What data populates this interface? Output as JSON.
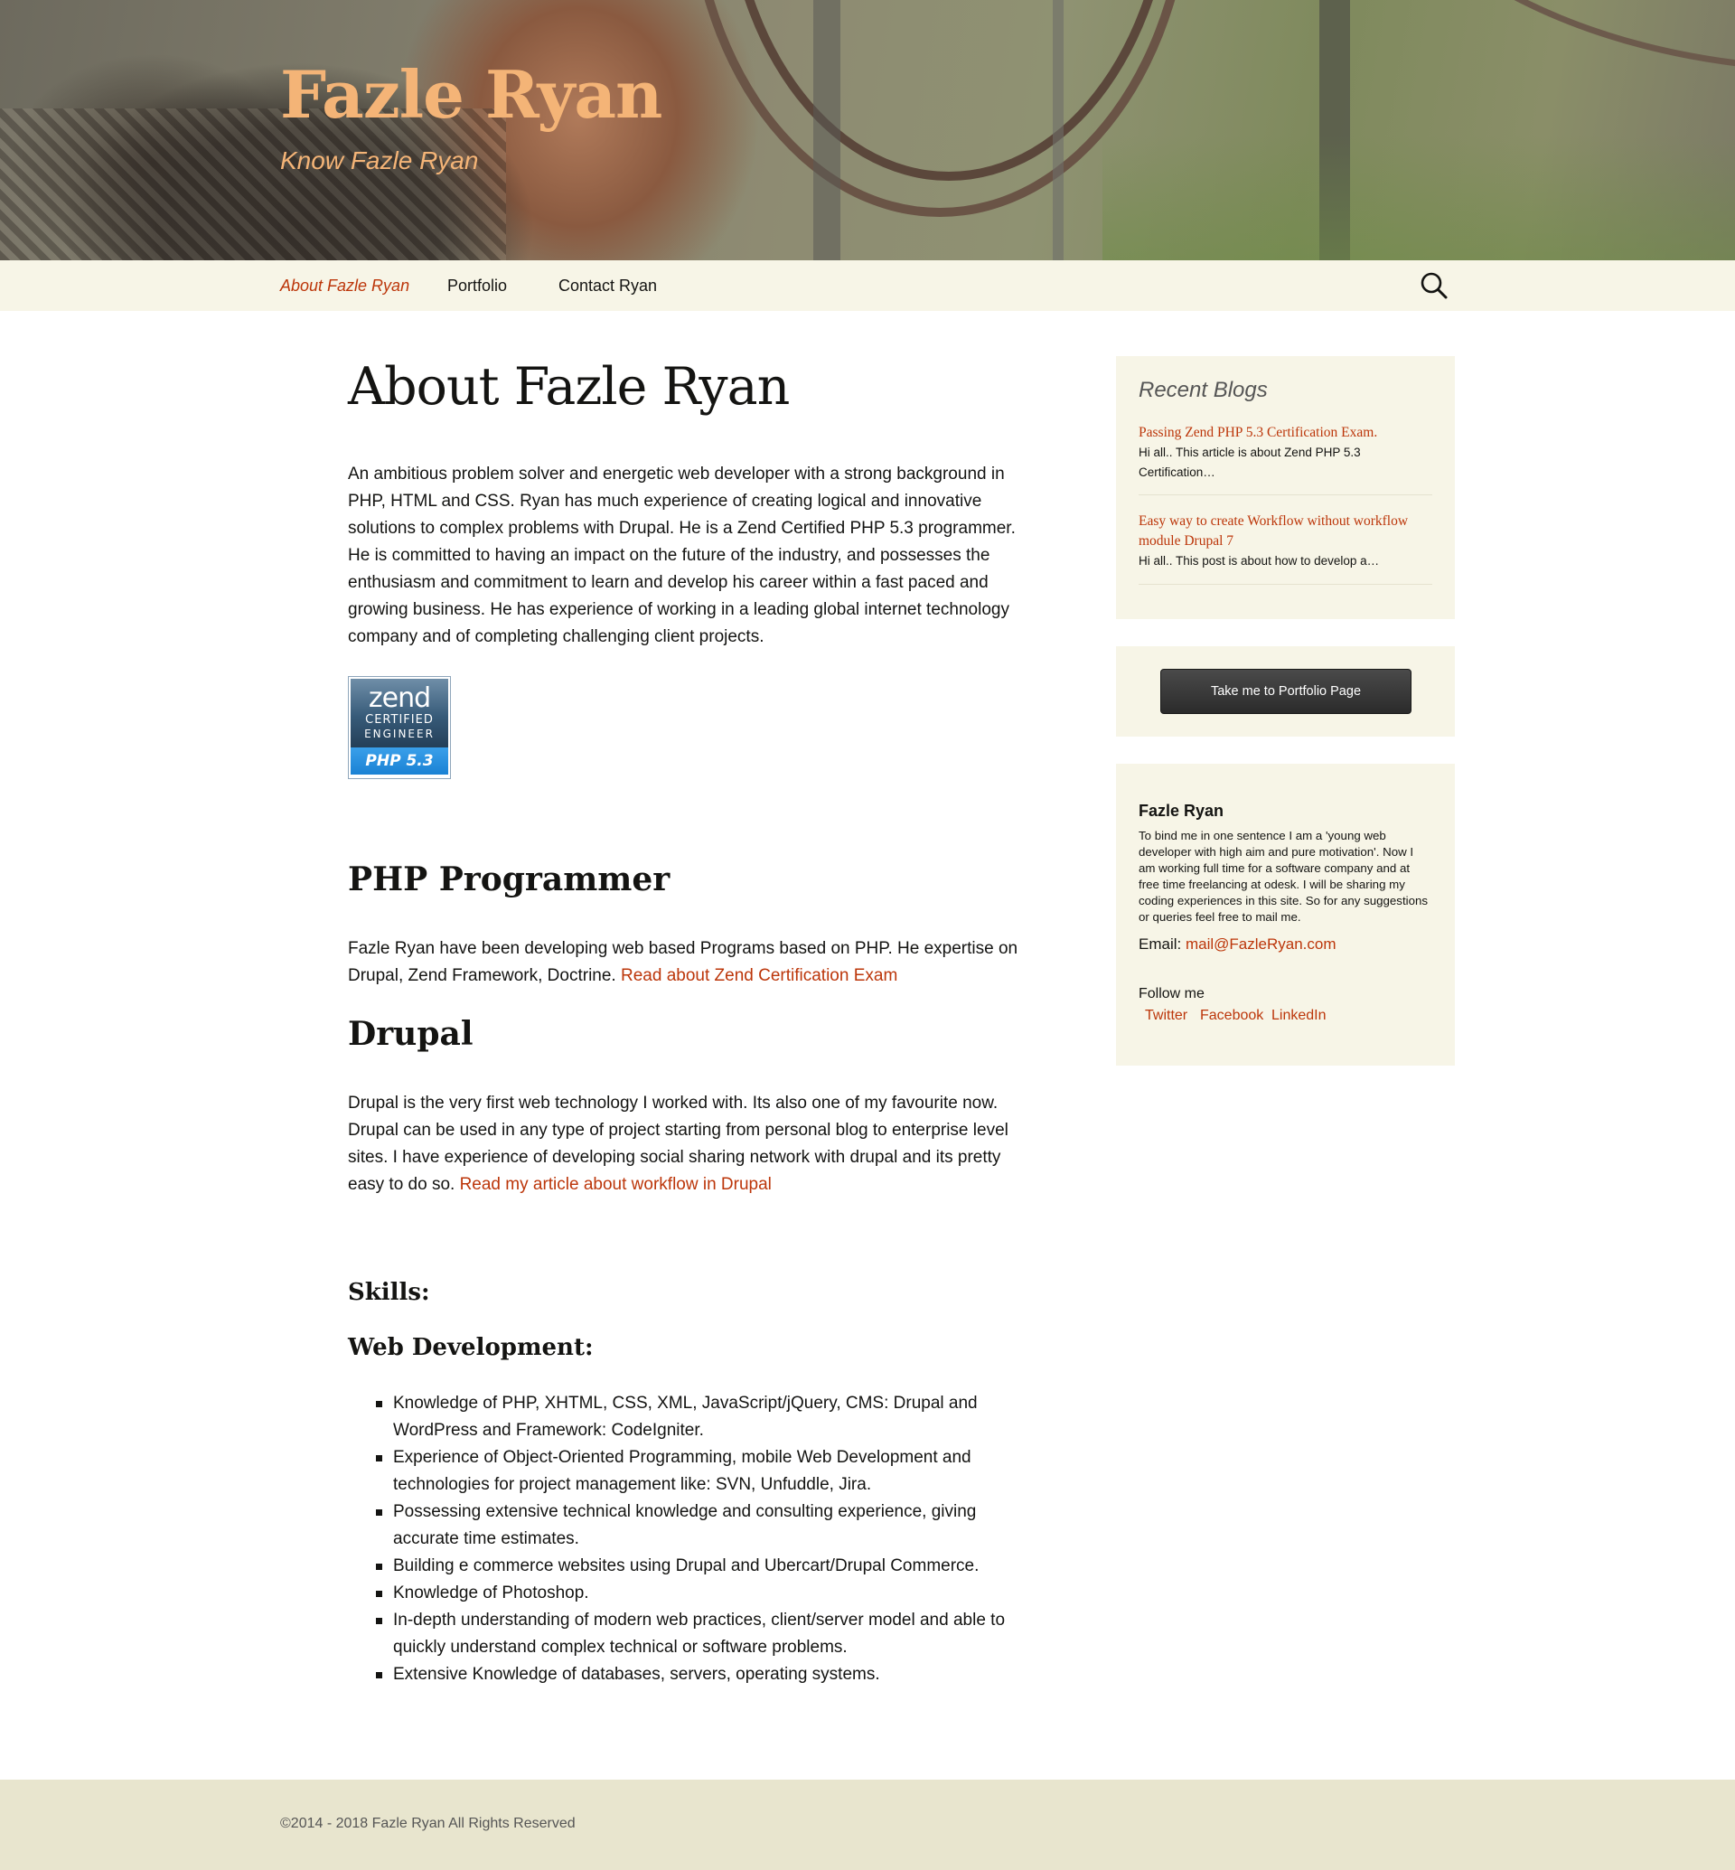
{
  "site": {
    "title": "Fazle Ryan",
    "tagline": "Know Fazle Ryan"
  },
  "nav": {
    "items": [
      {
        "label": "About Fazle Ryan",
        "active": true
      },
      {
        "label": "Portfolio",
        "active": false
      },
      {
        "label": "Contact Ryan",
        "active": false
      }
    ],
    "search_icon": "search-icon"
  },
  "main": {
    "title": "About Fazle Ryan",
    "intro": "An ambitious problem solver and energetic web developer with a strong background in PHP, HTML and CSS. Ryan has much experience of creating logical and innovative solutions to complex problems with Drupal. He is a Zend Certified PHP 5.3 programmer. He is committed to having an impact on the future of the industry, and possesses the enthusiasm and commitment to learn and develop his career within a fast paced and growing business. He has experience of working in a leading global internet technology company and of completing challenging client projects.",
    "badge": {
      "word": "zend",
      "line1": "CERTIFIED",
      "line2": "ENGINEER",
      "version": "PHP 5.3"
    },
    "php": {
      "heading": "PHP Programmer",
      "text": "Fazle Ryan have been developing web based Programs based on PHP. He expertise on Drupal, Zend Framework, Doctrine. ",
      "link": "Read about Zend Certification Exam"
    },
    "drupal": {
      "heading": "Drupal",
      "text": "Drupal is the very first web technology I worked with. Its also one of my favourite now. Drupal can be used in any type of project starting from personal blog to enterprise level sites. I have experience of developing social sharing network with drupal and its pretty easy to do so. ",
      "link": "Read my article about workflow in Drupal"
    },
    "skills_heading": "Skills:",
    "webdev_heading": "Web Development:",
    "skills": [
      "Knowledge of PHP, XHTML, CSS, XML, JavaScript/jQuery, CMS: Drupal and WordPress and Framework: CodeIgniter.",
      "Experience of Object-Oriented Programming, mobile Web Development and technologies for project management like:  SVN, Unfuddle, Jira.",
      "Possessing extensive technical knowledge and consulting experience, giving accurate time estimates.",
      "Building e commerce websites using Drupal and Ubercart/Drupal Commerce.",
      "Knowledge of Photoshop.",
      "In-depth understanding of modern web practices, client/server model and able to quickly understand complex technical or software problems.",
      "Extensive Knowledge of databases, servers, operating systems."
    ]
  },
  "sidebar": {
    "recent": {
      "title": "Recent Blogs",
      "posts": [
        {
          "title": "Passing Zend PHP 5.3 Certification Exam.",
          "excerpt": "Hi all.. This article is about Zend PHP 5.3 Certification…"
        },
        {
          "title": "Easy way to create Workflow without workflow module Drupal 7",
          "excerpt": "Hi all.. This post is about how to develop a…"
        }
      ]
    },
    "portfolio_button": "Take me to Portfolio Page",
    "author": {
      "name": "Fazle Ryan",
      "bio": "To bind me in one sentence I am a 'young web developer with high aim and pure motivation'. Now I am working full time for a software company and at free time freelancing at odesk. I will be sharing my coding experiences in this site. So for any suggestions or queries feel free to mail me.",
      "email_label": "Email: ",
      "email": "mail@FazleRyan.com",
      "follow_label": "Follow me",
      "social": [
        "Twitter",
        "Facebook",
        "LinkedIn"
      ]
    }
  },
  "footer": {
    "text": "©2014 - 2018 Fazle Ryan All Rights Reserved"
  },
  "colors": {
    "accent": "#bc360a",
    "title": "#f4b477",
    "navbar": "#f7f5e7",
    "footer": "#e8e5ce"
  }
}
